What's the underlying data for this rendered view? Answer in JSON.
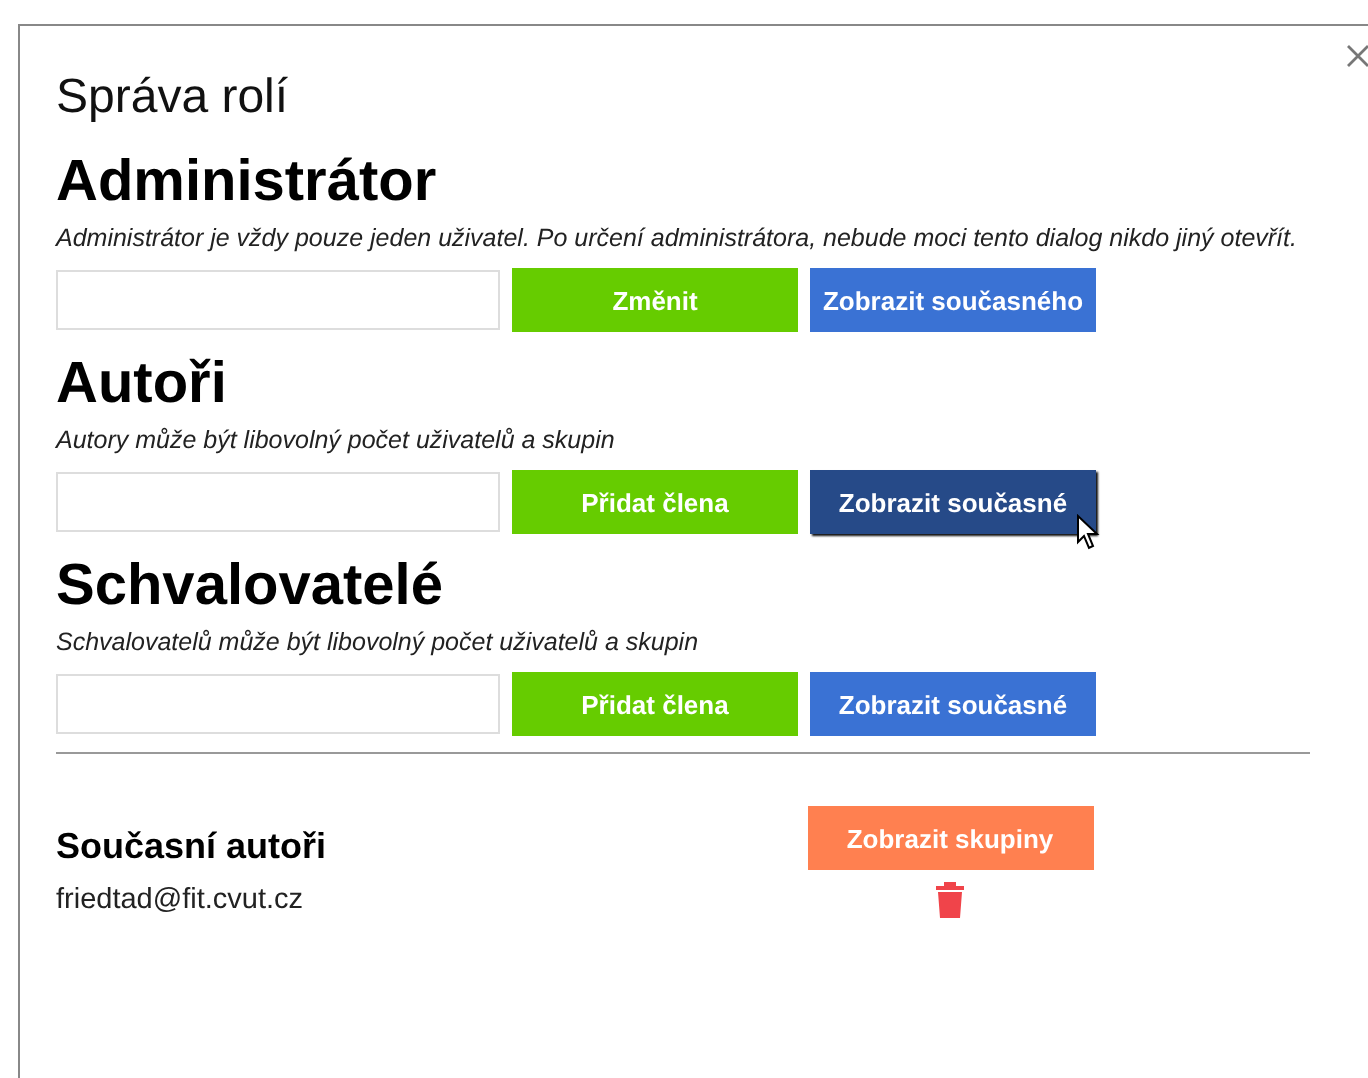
{
  "dialog": {
    "title": "Správa rolí"
  },
  "sections": [
    {
      "title": "Administrátor",
      "description": "Administrátor je vždy pouze jeden uživatel. Po určení administrátora, nebude moci tento dialog nikdo jiný otevřít.",
      "buttons": [
        {
          "label": "Změnit",
          "kind": "add",
          "hovered": false
        },
        {
          "label": "Zobrazit současného",
          "kind": "show",
          "hovered": false
        }
      ]
    },
    {
      "title": "Autoři",
      "description": "Autory může být libovolný počet uživatelů a skupin",
      "buttons": [
        {
          "label": "Přidat člena",
          "kind": "add",
          "hovered": false
        },
        {
          "label": "Zobrazit současné",
          "kind": "show",
          "hovered": true
        }
      ]
    },
    {
      "title": "Schvalovatelé",
      "description": "Schvalovatelů může být libovolný počet uživatelů a skupin",
      "buttons": [
        {
          "label": "Přidat člena",
          "kind": "add",
          "hovered": false
        },
        {
          "label": "Zobrazit současné",
          "kind": "show",
          "hovered": false
        }
      ]
    }
  ],
  "current": {
    "title": "Současní autoři",
    "button": "Zobrazit skupiny",
    "members": [
      {
        "email": "friedtad@fit.cvut.cz"
      }
    ]
  }
}
